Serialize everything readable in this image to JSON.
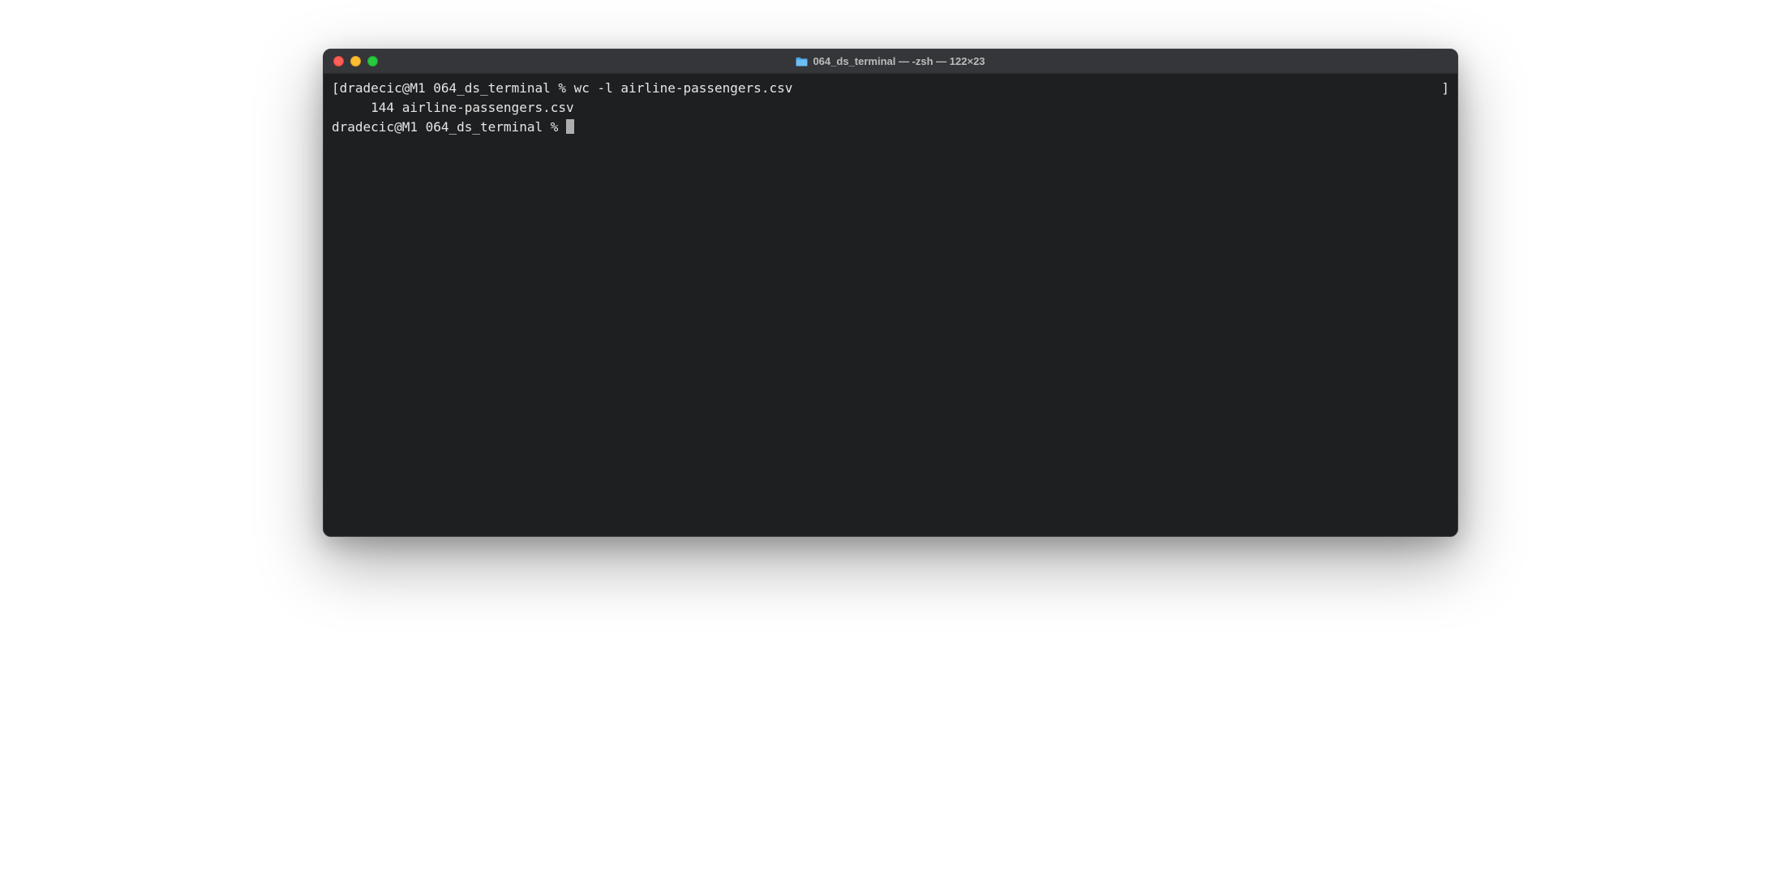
{
  "window": {
    "title": "064_ds_terminal — -zsh — 122×23"
  },
  "terminal": {
    "lines": [
      {
        "left_bracket": "[",
        "prompt": "dradecic@M1 064_ds_terminal % ",
        "command": "wc -l airline-passengers.csv",
        "right_bracket": "]"
      },
      {
        "text": "     144 airline-passengers.csv"
      },
      {
        "prompt": "dradecic@M1 064_ds_terminal % "
      }
    ]
  }
}
